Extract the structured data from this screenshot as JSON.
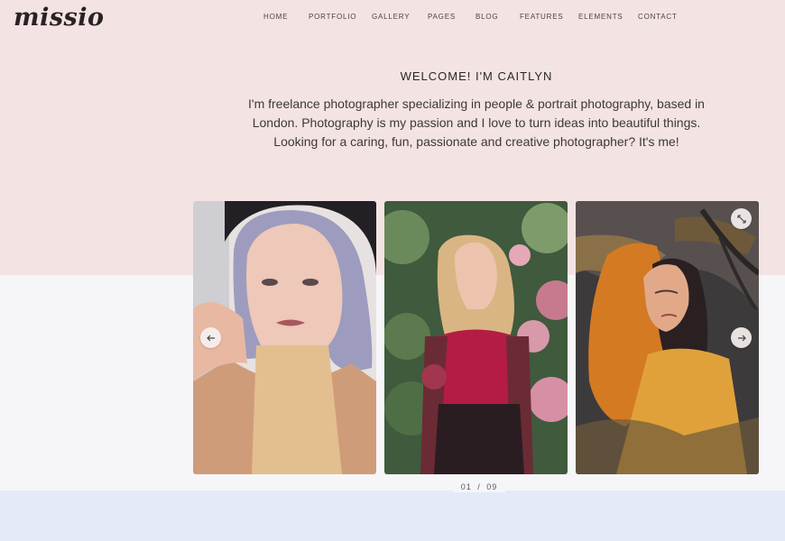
{
  "logo": {
    "text": "missio"
  },
  "nav": {
    "items": [
      {
        "label": "HOME"
      },
      {
        "label": "PORTFOLIO"
      },
      {
        "label": "GALLERY"
      },
      {
        "label": "PAGES"
      },
      {
        "label": "BLOG"
      },
      {
        "label": "FEATURES"
      },
      {
        "label": "ELEMENTS"
      },
      {
        "label": "CONTACT"
      }
    ]
  },
  "hero": {
    "title": "WELCOME! I'M CAITLYN",
    "text": "I'm freelance photographer specializing in people & portrait photography, based in London. Photography is my passion and I love to turn ideas into beautiful things. Looking for a caring, fun, passionate and creative photographer? It's me!"
  },
  "gallery": {
    "current": "01",
    "separator": "/",
    "total": "09",
    "icons": {
      "prev": "arrow-left-icon",
      "next": "arrow-right-icon",
      "expand": "expand-icon"
    }
  },
  "colors": {
    "top_band": "#f4e3e3",
    "middle_band": "#f6f6f8",
    "bottom_band": "#e4eaf8",
    "text": "#2e2a2b"
  }
}
